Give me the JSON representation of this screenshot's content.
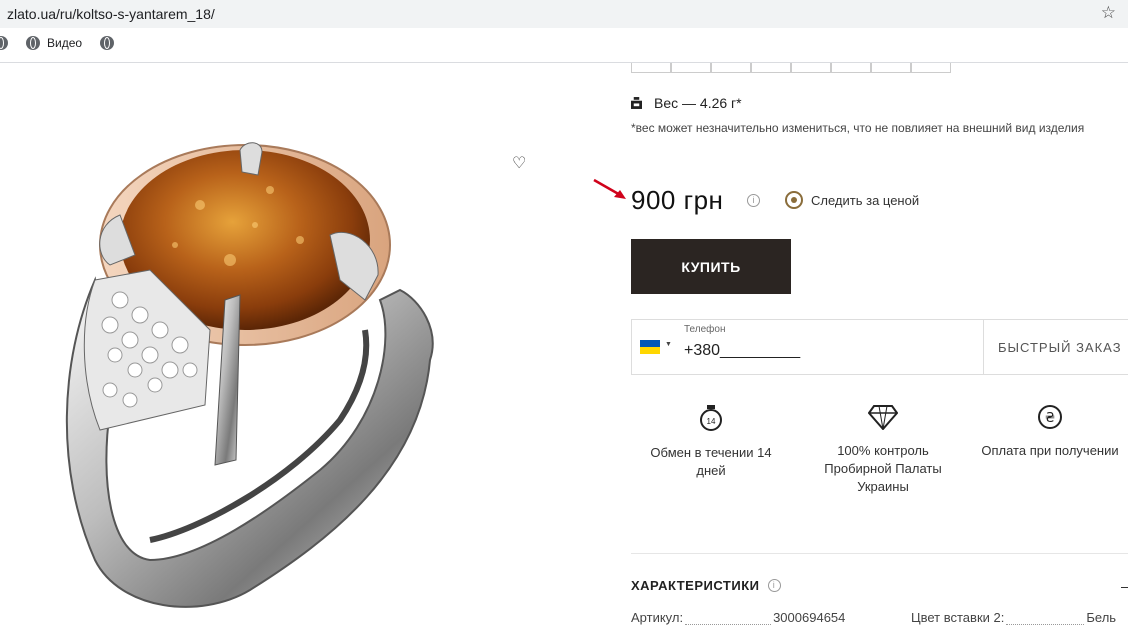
{
  "browser": {
    "url": "zlato.ua/ru/koltso-s-yantarem_18/",
    "bookmark_video": "Видео"
  },
  "product": {
    "weight": "Вес — 4.26 г*",
    "weight_note": "*вес может незначительно измениться, что не повлияет на внешний вид изделия",
    "price": "900 грн",
    "track_price": "Следить за ценой",
    "buy_label": "КУПИТЬ"
  },
  "quick_order": {
    "phone_label": "Телефон",
    "phone_value": "+380_________",
    "button": "БЫСТРЫЙ ЗАКАЗ"
  },
  "features": [
    {
      "icon": "exchange-14-icon",
      "text": "Обмен в течении 14 дней"
    },
    {
      "icon": "diamond-icon",
      "text": "100% контроль Пробирной Палаты Украины"
    },
    {
      "icon": "hryvnia-icon",
      "text": "Оплата при получении"
    }
  ],
  "specs": {
    "title": "ХАРАКТЕРИСТИКИ",
    "article_label": "Артикул:",
    "article_value": "3000694654",
    "insert_color_label": "Цвет вставки 2:",
    "insert_color_value": "Бель"
  },
  "colors": {
    "buy_bg": "#2b2522",
    "accent": "#8a6d3b",
    "arrow": "#d0021b"
  }
}
